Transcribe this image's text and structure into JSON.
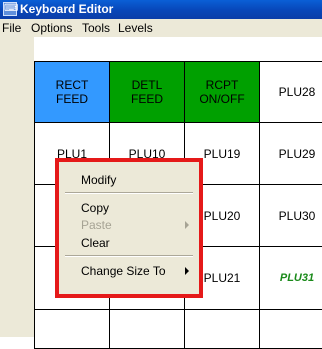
{
  "window": {
    "title": "Keyboard Editor"
  },
  "menubar": {
    "items": [
      "File",
      "Options",
      "Tools",
      "Levels"
    ]
  },
  "keys": {
    "rect_feed": "RECT\nFEED",
    "detl_feed": "DETL\nFEED",
    "rcpt_onoff": "RCPT\nON/OFF",
    "plu28": "PLU28",
    "plu1": "PLU1",
    "plu10": "PLU10",
    "plu19": "PLU19",
    "plu29": "PLU29",
    "plu20": "PLU20",
    "plu30": "PLU30",
    "plu21": "PLU21",
    "plu31": "PLU31"
  },
  "context_menu": {
    "modify": "Modify",
    "copy": "Copy",
    "paste": "Paste",
    "clear": "Clear",
    "change_size_to": "Change Size To"
  },
  "colors": {
    "titlebar": "#0846b8",
    "key_blue": "#3399ff",
    "key_green": "#00a000",
    "highlight_border": "#e51919",
    "plu31_text": "#1a8a1a"
  }
}
